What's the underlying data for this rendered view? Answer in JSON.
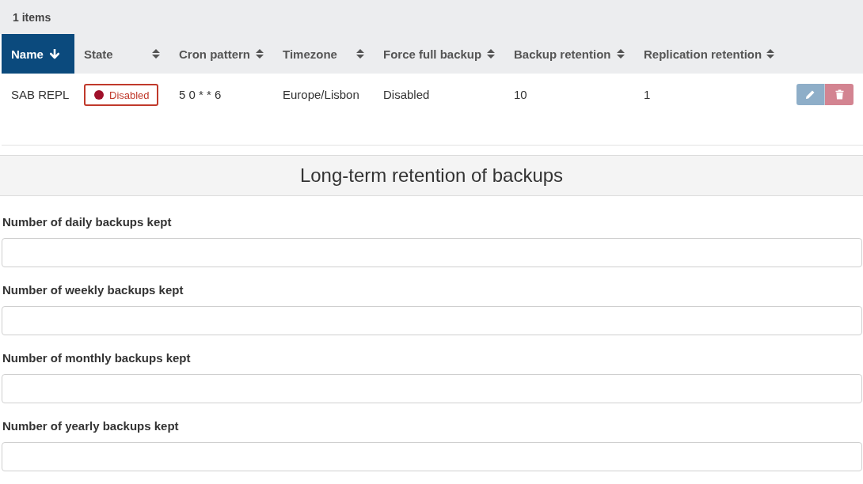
{
  "toolbar": {
    "item_count": "1 items"
  },
  "table": {
    "columns": [
      {
        "label": "Name",
        "selected": true,
        "sorted": true
      },
      {
        "label": "State",
        "selected": false,
        "sorted": false
      },
      {
        "label": "Cron pattern",
        "selected": false,
        "sorted": false
      },
      {
        "label": "Timezone",
        "selected": false,
        "sorted": false
      },
      {
        "label": "Force full backup",
        "selected": false,
        "sorted": false
      },
      {
        "label": "Backup retention",
        "selected": false,
        "sorted": false
      },
      {
        "label": "Replication retention",
        "selected": false,
        "sorted": false
      }
    ],
    "rows": [
      {
        "name": "SAB REPL",
        "state": {
          "label": "Disabled",
          "enabled": false
        },
        "cron_pattern": "5 0 * * 6",
        "timezone": "Europe/Lisbon",
        "force_full_backup": "Disabled",
        "backup_retention": "10",
        "replication_retention": "1",
        "actions": [
          {
            "kind": "edit",
            "disabled": true
          },
          {
            "kind": "delete",
            "disabled": true
          }
        ]
      }
    ]
  },
  "retention_section": {
    "title": "Long-term retention of backups",
    "fields": [
      {
        "label": "Number of daily backups kept"
      },
      {
        "label": "Number of weekly backups kept"
      },
      {
        "label": "Number of monthly backups kept"
      },
      {
        "label": "Number of yearly backups kept"
      }
    ]
  }
}
